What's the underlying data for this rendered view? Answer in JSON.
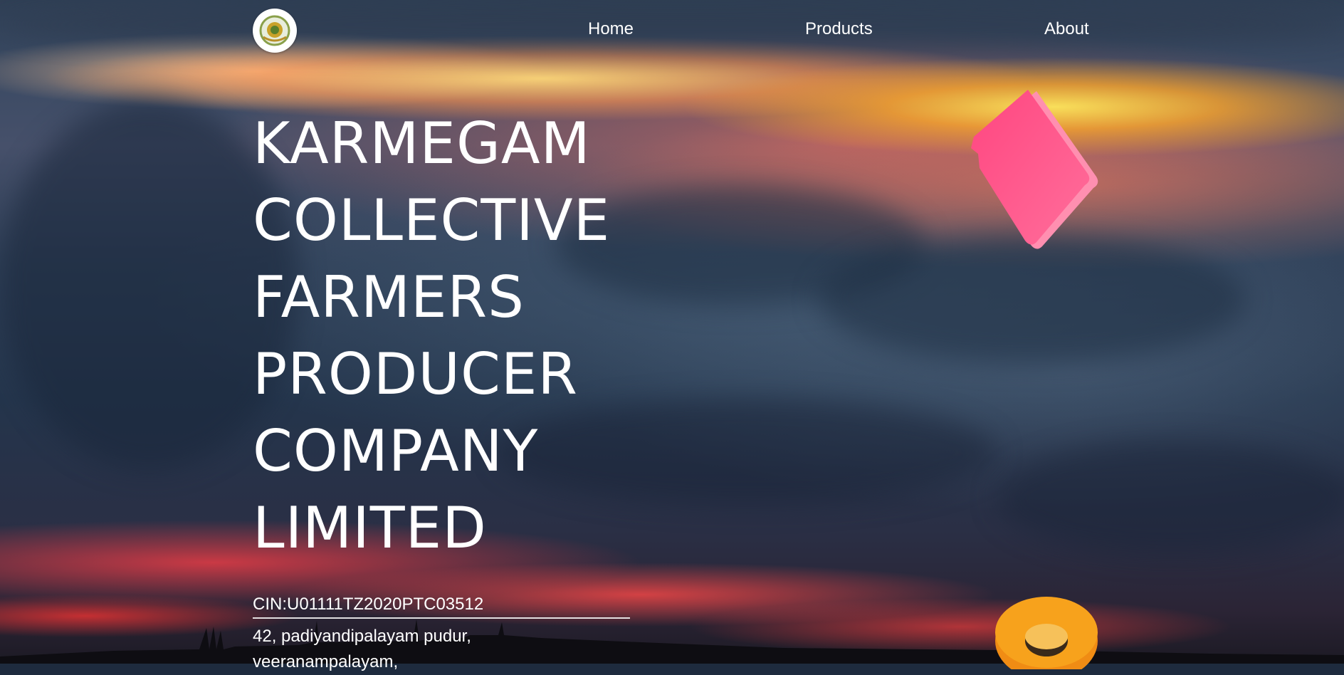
{
  "nav": {
    "logo_name": "company-logo",
    "links": [
      {
        "label": "Home"
      },
      {
        "label": "Products"
      },
      {
        "label": "About"
      }
    ]
  },
  "hero": {
    "title_lines": [
      "KARMEGAM",
      "COLLECTIVE",
      "FARMERS",
      "PRODUCER",
      "COMPANY",
      "LIMITED"
    ],
    "cin": "CIN:U01111TZ2020PTC03512",
    "address_lines": [
      "42, padiyandipalayam pudur,",
      "veeranampalayam,"
    ]
  },
  "colors": {
    "text": "#ffffff",
    "pink_shape": "#ff4f86",
    "orange_ring": "#f7a21c"
  }
}
